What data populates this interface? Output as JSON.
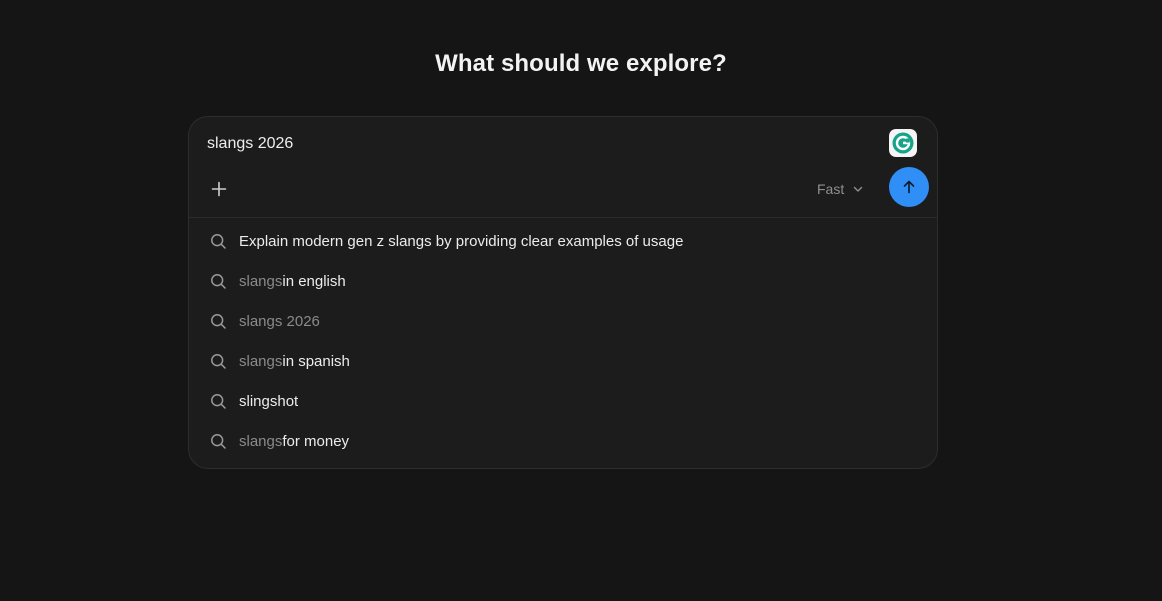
{
  "page_title": "What should we explore?",
  "search": {
    "value": "slangs 2026",
    "model_label": "Fast"
  },
  "icons": {
    "add": "plus-icon",
    "model_dropdown": "chevron-down-icon",
    "submit": "arrow-up-icon",
    "suggestion": "search-icon",
    "extension": "grammarly-icon"
  },
  "colors": {
    "background": "#151515",
    "card": "#1d1c1c",
    "accent": "#2f8ff6",
    "grammarly": "#15a38a"
  },
  "suggestions": [
    {
      "muted": "",
      "strong": "Explain modern gen z slangs by providing clear examples of usage"
    },
    {
      "muted": "slangs",
      "strong": " in english"
    },
    {
      "muted": "slangs 2026",
      "strong": ""
    },
    {
      "muted": "slangs",
      "strong": " in spanish"
    },
    {
      "muted": "",
      "strong": "slingshot"
    },
    {
      "muted": "slangs",
      "strong": " for money"
    }
  ]
}
